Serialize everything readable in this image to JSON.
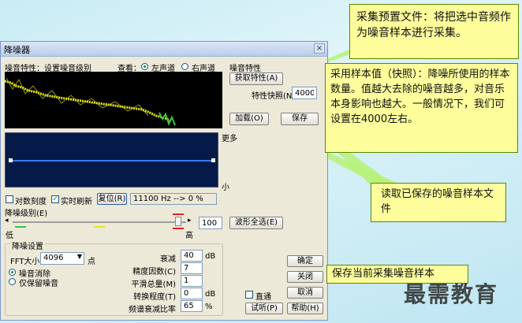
{
  "window": {
    "title": "降噪器",
    "close_glyph": "×"
  },
  "top": {
    "noise_profile_label": "噪音特性：设置噪音级别",
    "view_label": "查看：",
    "left_channel": "左声道",
    "right_channel": "右声道"
  },
  "noise_profile": {
    "heading": "噪音特性",
    "get_profile_button": "获取特性(A)",
    "snapshots_label": "特性快照(N)",
    "snapshots_value": "4000",
    "load_button": "加载(O)",
    "save_button": "保存"
  },
  "graph": {
    "more_label": "更多",
    "less_label": "小"
  },
  "options": {
    "log_scale": "对数刻度",
    "live_update": "实时刷新",
    "reset_button": "复位(R)",
    "freq_readout": "11100 Hz --> 0 %"
  },
  "reduction": {
    "level_label": "降噪级别(E)",
    "low_label": "低",
    "high_label": "高",
    "level_value": "100",
    "level_fraction": 1.0,
    "select_entire_button": "波形全选(E)"
  },
  "settings": {
    "heading": "降噪设置",
    "fft_label": "FFT大小",
    "fft_value": "4096",
    "fft_unit": "点",
    "remove_noise": "噪音消除",
    "keep_noise": "仅保留噪音",
    "params": [
      {
        "label": "衰减",
        "value": "40",
        "unit": "dB"
      },
      {
        "label": "精度因数(C)",
        "value": "7",
        "unit": ""
      },
      {
        "label": "平滑总量(M)",
        "value": "1",
        "unit": ""
      },
      {
        "label": "转换程度(T)",
        "value": "0",
        "unit": "dB"
      },
      {
        "label": "频谱衰减比率",
        "value": "65",
        "unit": "%"
      }
    ]
  },
  "actions": {
    "ok": "确定",
    "close": "关闭",
    "cancel": "取消",
    "help": "帮助(H)",
    "bypass": "直通",
    "preview": "试听(P)"
  },
  "callouts": {
    "c1": "采集预置文件：将把选中音频作为噪音样本进行采集。",
    "c2": "采用样本值（快照）：降噪所使用的样本数量。值越大去除的噪音越多，对音乐本身影响也越大。一般情况下，我们可设置在4000左右。",
    "c3": "读取已保存的噪音样本文件",
    "c4": "保存当前采集噪音样本"
  },
  "watermark": "最需教育",
  "colors": {
    "callout_bg": "#fdfd9c",
    "callout_pointer": "#b8f27a",
    "spectrum_yellow": "#e8e81a",
    "spectrum_green": "#3ec43e",
    "graph_line": "#3a78ff"
  },
  "icons": [
    "close-icon",
    "dropdown-arrow-icon",
    "slider-left-arrow-icon",
    "slider-right-arrow-icon"
  ]
}
